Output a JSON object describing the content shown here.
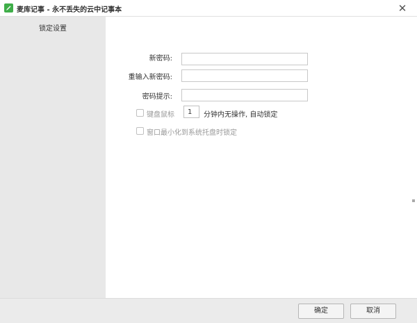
{
  "window": {
    "title": "麦库记事 - 永不丢失的云中记事本",
    "close_symbol": "✕"
  },
  "sidebar": {
    "items": [
      {
        "label": "锁定设置"
      }
    ]
  },
  "form": {
    "new_password_label": "新密码:",
    "new_password_value": "",
    "confirm_password_label": "重输入新密码:",
    "confirm_password_value": "",
    "hint_label": "密码提示:",
    "hint_value": "",
    "keyboard_mouse_label": "键盘鼠标",
    "keyboard_mouse_checked": false,
    "idle_minutes": "1",
    "idle_suffix": "分钟内无操作, 自动锁定",
    "minimize_lock_label": "窗口最小化到系统托盘时锁定",
    "minimize_lock_checked": false
  },
  "footer": {
    "ok_label": "确定",
    "cancel_label": "取消"
  },
  "colors": {
    "brand": "#3fae49",
    "sidebar_bg": "#e8e8e8",
    "footer_bg": "#ebebeb"
  }
}
